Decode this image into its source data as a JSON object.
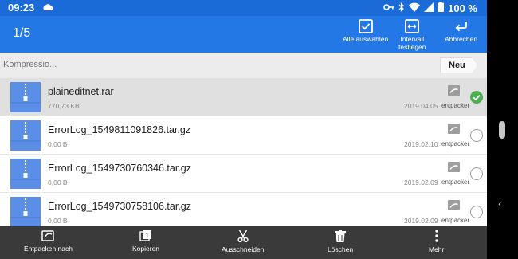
{
  "status": {
    "time": "09:23",
    "battery": "100 %",
    "icons": [
      "cloud-icon",
      "key-icon",
      "bluetooth-icon",
      "wifi-icon",
      "signal-icon",
      "battery-icon"
    ]
  },
  "actionbar": {
    "count": "1/5",
    "select_all": "Alle auswählen",
    "interval": "Intervall\nfestlegen",
    "cancel": "Abbrechen"
  },
  "breadcrumb": {
    "path": "Kompressio...",
    "new_label": "Neu"
  },
  "files": [
    {
      "name": "plaineditnet.rar",
      "size": "770,73 KB",
      "date": "2019.04.05",
      "ext_label": "entpacken",
      "selected": true
    },
    {
      "name": "ErrorLog_1549811091826.tar.gz",
      "size": "0,00 B",
      "date": "2019.02.10",
      "ext_label": "entpacken",
      "selected": false
    },
    {
      "name": "ErrorLog_1549730760346.tar.gz",
      "size": "0,00 B",
      "date": "2019.02.09",
      "ext_label": "entpacken",
      "selected": false
    },
    {
      "name": "ErrorLog_1549730758106.tar.gz",
      "size": "0,00 B",
      "date": "2019.02.09",
      "ext_label": "entpacken",
      "selected": false
    }
  ],
  "bottombar": {
    "extract_to": "Entpacken nach",
    "copy": "Kopieren",
    "cut": "Ausschneiden",
    "delete": "Löschen",
    "more": "Mehr"
  },
  "colors": {
    "statusbar": "#1a6bd8",
    "actionbar": "#2378e6",
    "archive_icon": "#5b8ee6",
    "selected_check": "#4caf50",
    "bottombar": "#3a3a3a"
  }
}
